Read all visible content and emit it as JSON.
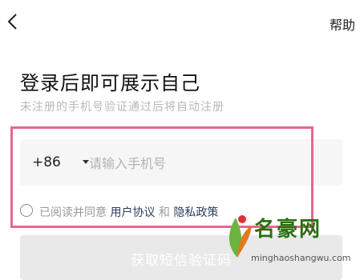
{
  "header": {
    "back_icon": "chevron-left-icon",
    "help_label": "帮助"
  },
  "login": {
    "title": "登录后即可展示自己",
    "subtitle": "未注册的手机号验证通过后将自动注册",
    "country_code": "+86",
    "phone_placeholder": "请输入手机号",
    "phone_value": "",
    "agreement_checked": false,
    "agreement_prefix": "已阅读并同意",
    "user_agreement": "用户协议",
    "conjunction": "和",
    "privacy_policy": "隐私政策",
    "get_code_button": "获取短信验证码"
  },
  "watermark": {
    "brand": "名豪网",
    "domain": "minghaoshangwu.com"
  },
  "colors": {
    "highlight": "#e8668f",
    "link": "#2b3d63",
    "button_disabled": "#e9e9e9",
    "watermark_green": "#2a6e12"
  }
}
